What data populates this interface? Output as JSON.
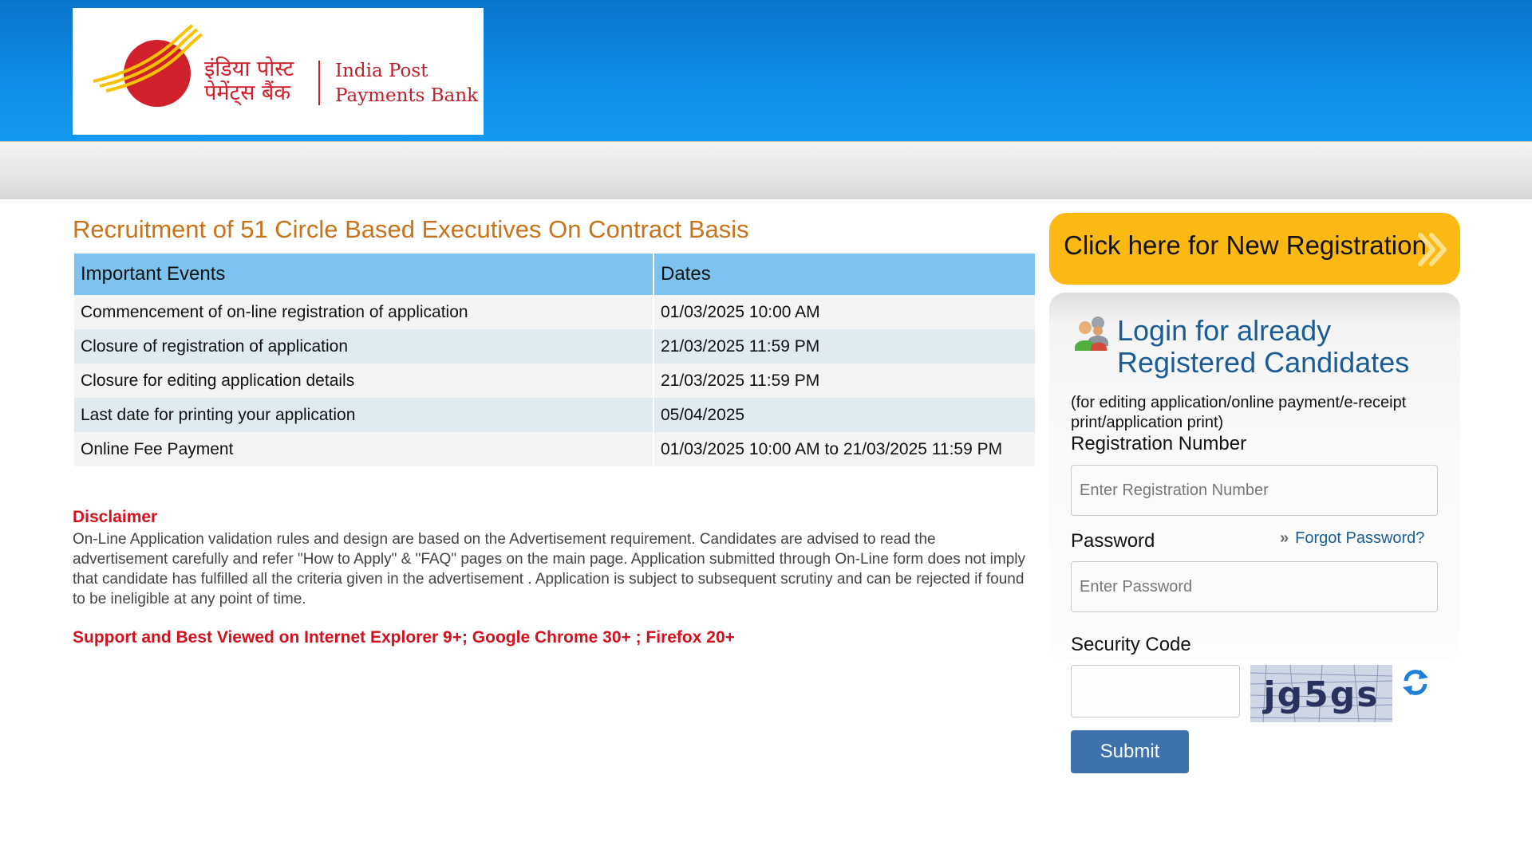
{
  "header": {
    "logo_hindi": "इंडिया पोस्ट\nपेमेंट्स बैंक",
    "logo_line1": "India Post",
    "logo_line2": "Payments Bank",
    "brand_color": "#d0202b"
  },
  "main": {
    "title": "Recruitment of 51 Circle Based Executives On Contract Basis",
    "table": {
      "headers": [
        "Important Events",
        "Dates"
      ],
      "rows": [
        [
          "Commencement of on-line registration of application",
          "01/03/2025 10:00 AM"
        ],
        [
          "Closure of registration of application",
          "21/03/2025 11:59 PM"
        ],
        [
          "Closure for editing application details",
          "21/03/2025 11:59 PM"
        ],
        [
          "Last date for printing your application",
          "05/04/2025"
        ],
        [
          "Online Fee Payment",
          "01/03/2025 10:00 AM to 21/03/2025 11:59 PM"
        ]
      ]
    },
    "disclaimer_title": "Disclaimer",
    "disclaimer_text": "On-Line Application validation rules and design are based on the Advertisement requirement. Candidates are advised to read the advertisement carefully and refer \"How to Apply\" & \"FAQ\" pages on the main page. Application submitted through On-Line form does not imply that candidate has fulfilled all the criteria given in the advertisement . Application is subject to subsequent scrutiny and can be rejected if found to be ineligible at any point of time.",
    "support_note": "Support and Best Viewed on Internet Explorer 9+; Google Chrome 30+ ; Firefox 20+"
  },
  "sidebar": {
    "new_registration_label": "Click here for New Registration",
    "login_title_line1": "Login for already",
    "login_title_line2": "Registered Candidates",
    "login_subtitle": "(for editing application/online payment/e-receipt print/application print)",
    "registration_label": "Registration Number",
    "registration_placeholder": "Enter Registration Number",
    "password_label": "Password",
    "forgot_password": "Forgot Password?",
    "password_placeholder": "Enter Password",
    "security_code_label": "Security Code",
    "captcha_text": "jg5gs",
    "submit_label": "Submit"
  },
  "colors": {
    "header_blue": "#0e8ee8",
    "title_orange": "#c8721a",
    "table_header": "#7cc3f0",
    "alert_red": "#d5101c",
    "cta_yellow": "#fdb913",
    "submit_blue": "#3d72ad",
    "link_blue": "#1a5c96"
  },
  "icons": {
    "users": "users-group-icon",
    "refresh": "refresh-icon",
    "chevron": "double-chevron-right-icon"
  }
}
